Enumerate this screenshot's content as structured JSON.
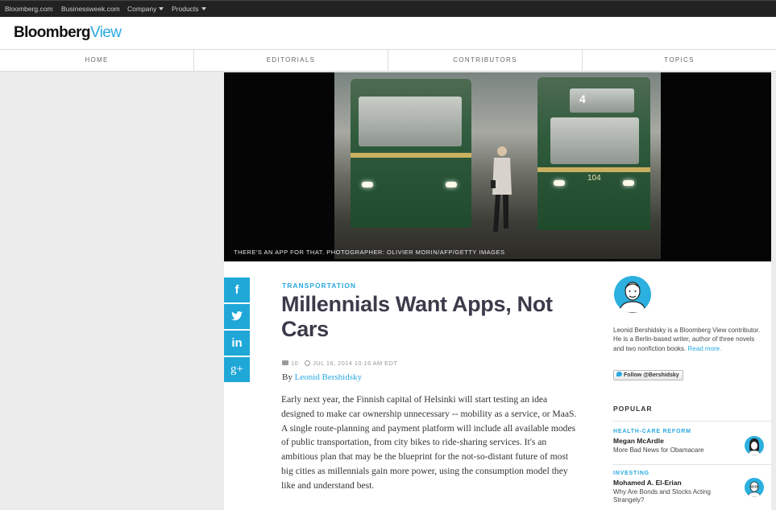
{
  "topbar": {
    "links": [
      "Bloomberg.com",
      "Businessweek.com",
      "Company",
      "Products"
    ]
  },
  "logo": {
    "part1": "Bloomberg",
    "part2": "View"
  },
  "nav": {
    "items": [
      "HOME",
      "EDITORIALS",
      "CONTRIBUTORS",
      "TOPICS"
    ]
  },
  "hero": {
    "caption": "THERE'S AN APP FOR THAT. PHOTOGRAPHER: OLIVIER MORIN/AFP/GETTY IMAGES",
    "tram_number": "104",
    "tram_route": "4"
  },
  "share": {
    "buttons": [
      "f",
      "t",
      "in",
      "g+"
    ]
  },
  "article": {
    "category": "TRANSPORTATION",
    "headline": "Millennials Want Apps, Not Cars",
    "comments": "10",
    "timestamp": "JUL 16, 2014 10:16 AM EDT",
    "by": "By",
    "author": "Leonid Bershidsky",
    "body": "Early next year, the Finnish capital of Helsinki will start testing an idea designed to make car ownership unnecessary -- mobility as a service, or MaaS. A single route-planning and payment platform will include all available modes of public transportation, from city bikes to ride-sharing services. It's an ambitious plan that may be the blueprint for the not-so-distant future of most big cities as millennials gain more power, using the consumption model they like and understand best."
  },
  "sidebar": {
    "bio": "Leonid Bershidsky is a Bloomberg View contributor. He is a Berlin-based writer, author of three novels and two nonfiction books.",
    "read_more": "Read more.",
    "follow": "Follow @Bershidsky",
    "popular_title": "POPULAR",
    "popular": [
      {
        "category": "HEALTH-CARE REFORM",
        "author": "Megan McArdle",
        "title": "More Bad News for Obamacare"
      },
      {
        "category": "INVESTING",
        "author": "Mohamed A. El-Erian",
        "title": "Why Are Bonds and Stocks Acting Strangely?"
      }
    ]
  },
  "colors": {
    "accent": "#29a8e0",
    "share": "#1fa7d8",
    "topbar": "#222222"
  }
}
